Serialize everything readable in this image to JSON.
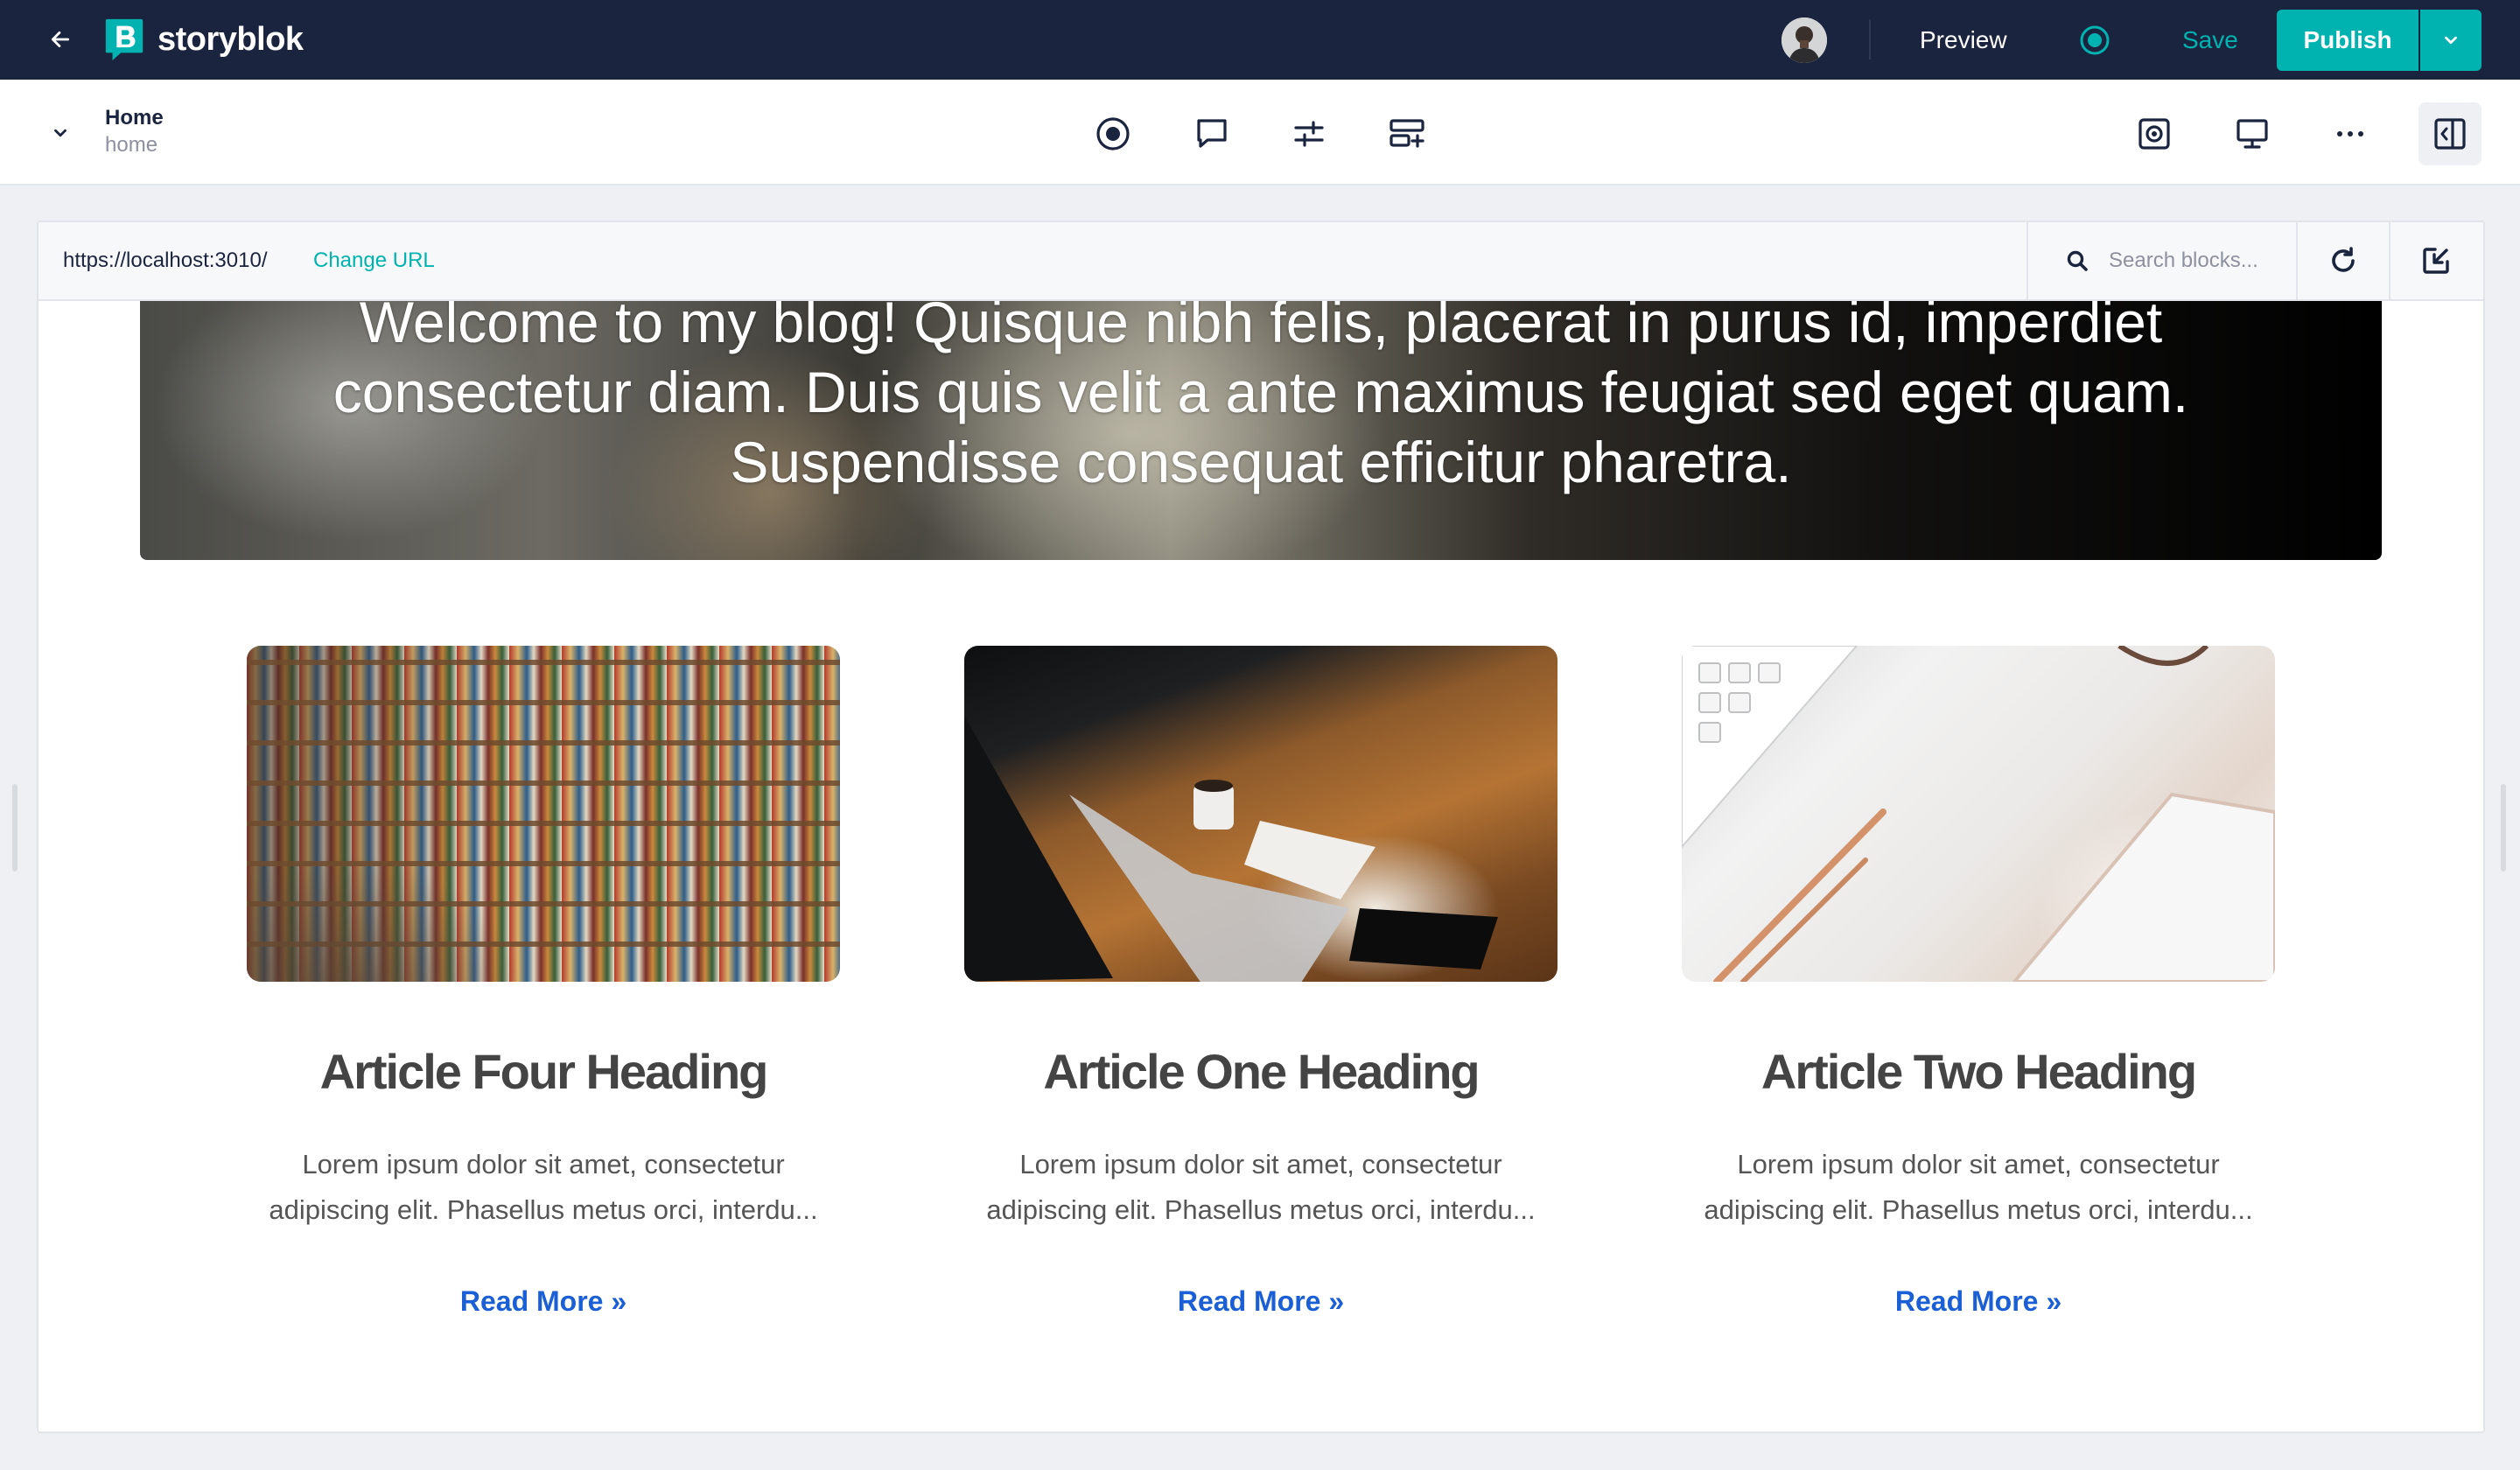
{
  "app": {
    "brand_name": "storyblok",
    "preview_label": "Preview",
    "save_label": "Save",
    "publish_label": "Publish"
  },
  "toolbar": {
    "story_title": "Home",
    "story_slug": "home"
  },
  "frame": {
    "url": "https://localhost:3010/",
    "change_url_label": "Change URL",
    "search_placeholder": "Search blocks..."
  },
  "page": {
    "hero_text": "Welcome to my blog! Quisque nibh felis, placerat in purus id, imperdiet consectetur diam. Duis quis velit a ante maximus feugiat sed eget quam. Suspendisse consequat efficitur pharetra.",
    "articles": [
      {
        "heading": "Article Four Heading",
        "excerpt": "Lorem ipsum dolor sit amet, consectetur adipiscing elit. Phasellus metus orci, interdu...",
        "link": "Read More »"
      },
      {
        "heading": "Article One Heading",
        "excerpt": "Lorem ipsum dolor sit amet, consectetur adipiscing elit. Phasellus metus orci, interdu...",
        "link": "Read More »"
      },
      {
        "heading": "Article Two Heading",
        "excerpt": "Lorem ipsum dolor sit amet, consectetur adipiscing elit. Phasellus metus orci, interdu...",
        "link": "Read More »"
      }
    ]
  },
  "colors": {
    "topbar_bg": "#1b243f",
    "accent": "#00b3b0",
    "link": "#1a5fd6"
  },
  "icons": [
    "arrow-left-icon",
    "storyblok-logo-icon",
    "chevron-down-icon",
    "target-icon",
    "comment-icon",
    "sliders-icon",
    "add-block-icon",
    "screenshot-icon",
    "monitor-icon",
    "more-icon",
    "panel-toggle-icon",
    "search-icon",
    "refresh-icon",
    "edit-check-icon"
  ]
}
